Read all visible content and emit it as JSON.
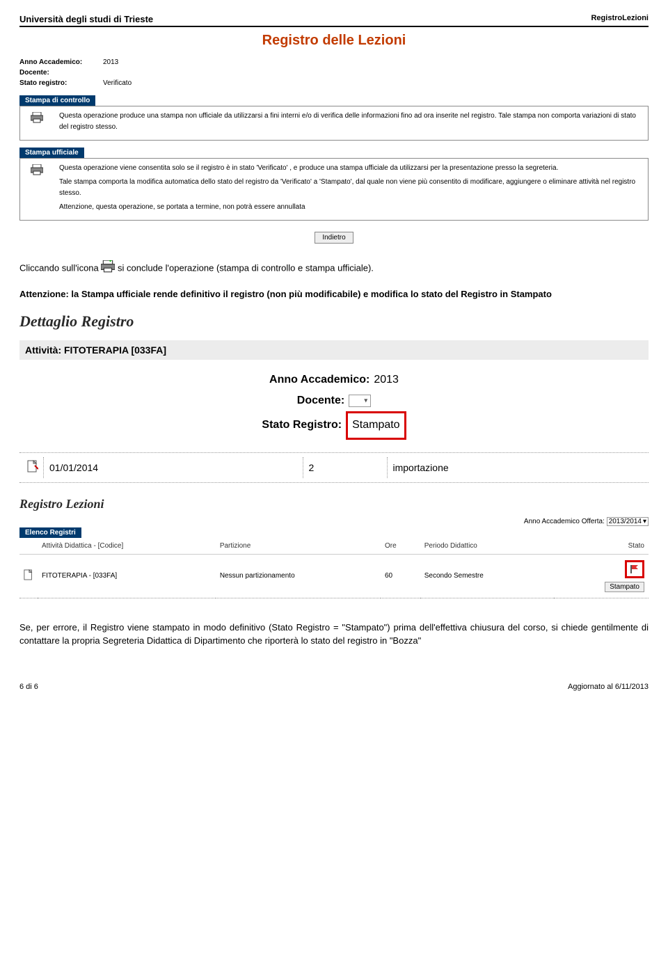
{
  "header": {
    "left": "Università degli studi di Trieste",
    "right": "RegistroLezioni",
    "main_title": "Registro delle Lezioni"
  },
  "meta": {
    "anno_label": "Anno Accademico:",
    "anno_value": "2013",
    "docente_label": "Docente:",
    "docente_value": "",
    "stato_label": "Stato registro:",
    "stato_value": "Verificato"
  },
  "stampa_controllo": {
    "title": "Stampa di controllo",
    "text": "Questa operazione produce una stampa non ufficiale da utilizzarsi a fini interni e/o di verifica delle informazioni fino ad ora inserite nel registro. Tale stampa non comporta variazioni di stato del registro stesso."
  },
  "stampa_ufficiale": {
    "title": "Stampa ufficiale",
    "line1": "Questa operazione viene consentita solo se il registro è in stato 'Verificato' , e produce una stampa ufficiale da utilizzarsi per la presentazione presso la segreteria.",
    "line2": "Tale stampa comporta la modifica automatica dello stato del registro da 'Verificato' a 'Stampato', dal quale non viene più consentito di modificare, aggiungere o eliminare attività nel registro stesso.",
    "line3": "Attenzione, questa operazione, se portata a termine, non potrà essere annullata"
  },
  "indietro_label": "Indietro",
  "paragraph1_a": "Cliccando sull'icona ",
  "paragraph1_b": " si conclude l'operazione (stampa di controllo e stampa ufficiale).",
  "paragraph2": "Attenzione: la Stampa ufficiale rende definitivo il registro (non più modificabile) e modifica lo stato del Registro in Stampato",
  "dettaglio": {
    "title": "Dettaglio Registro",
    "activity_label": "Attività: ",
    "activity_value": "FITOTERAPIA [033FA]",
    "anno_label": "Anno Accademico:",
    "anno_value": "2013",
    "docente_label": "Docente:",
    "docente_value": "",
    "stato_label": "Stato Registro:",
    "stato_value": "Stampato"
  },
  "row": {
    "date": "01/01/2014",
    "qty": "2",
    "desc": "importazione"
  },
  "registro_lezioni": {
    "title": "Registro Lezioni",
    "ay_label": "Anno Accademico Offerta:",
    "ay_value": "2013/2014"
  },
  "elenco": {
    "tab": "Elenco Registri",
    "headers": {
      "attivita": "Attività Didattica - [Codice]",
      "partizione": "Partizione",
      "ore": "Ore",
      "periodo": "Periodo Didattico",
      "stato": "Stato"
    },
    "row": {
      "attivita": "FITOTERAPIA - [033FA]",
      "partizione": "Nessun partizionamento",
      "ore": "60",
      "periodo": "Secondo Semestre",
      "stato_chip": "Stampato"
    }
  },
  "paragraph3": "Se, per errore, il Registro viene stampato in modo definitivo (Stato Registro = \"Stampato\") prima dell'effettiva chiusura del corso, si chiede gentilmente di contattare la propria Segreteria Didattica di Dipartimento che riporterà lo stato del registro in \"Bozza\"",
  "footer": {
    "left": "6 di 6",
    "right": "Aggiornato al 6/11/2013"
  },
  "icons": {
    "print": "print-icon",
    "doc": "doc-icon",
    "select": "select-arrow-icon",
    "flag": "flag-icon"
  }
}
